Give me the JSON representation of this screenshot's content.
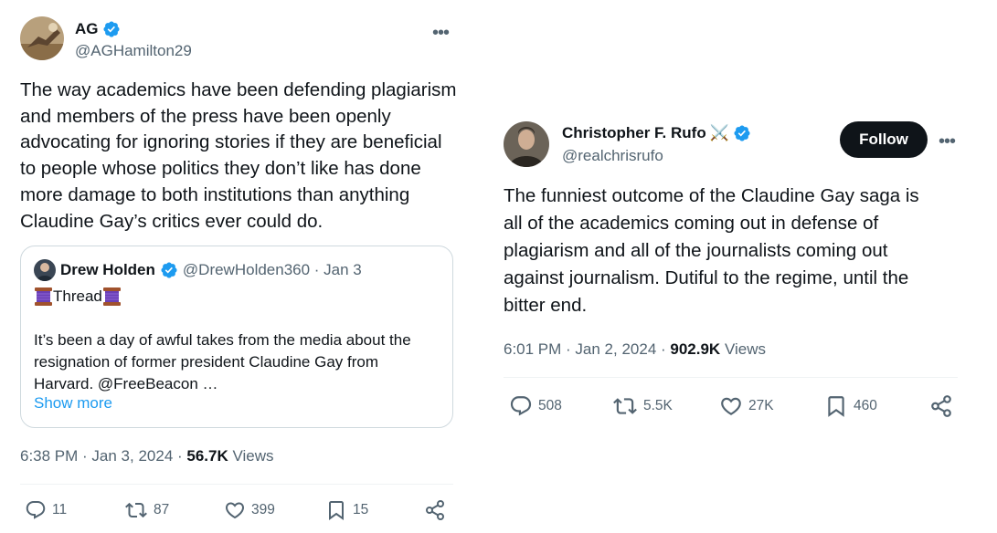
{
  "colors": {
    "verified": "#1d9bf0",
    "secondary_text": "#536471",
    "link": "#1d9bf0",
    "follow_bg": "#0f1419"
  },
  "left_tweet": {
    "display_name": "AG",
    "handle": "@AGHamilton29",
    "more_icon": "more-horizontal-icon",
    "text": "The way academics have been defending plagiarism\nand members of the press have been openly\nadvocating for ignoring stories if they are beneficial\nto people whose politics they don’t like has done\nmore damage to both institutions than anything\nClaudine Gay’s critics ever could do.",
    "quote": {
      "display_name": "Drew Holden",
      "handle_date": "@DrewHolden360 · Jan 3",
      "thread_label": "Thread",
      "text": "It’s been a day of awful takes from the media about the\nresignation of former president Claudine Gay from\nHarvard. @FreeBeacon …",
      "show_more": "Show more"
    },
    "timestamp": "6:38 PM · Jan 3, 2024 · ",
    "views_count": "56.7K",
    "views_label": " Views",
    "actions": {
      "replies": "11",
      "reposts": "87",
      "likes": "399",
      "bookmarks": "15"
    }
  },
  "right_tweet": {
    "display_name": "Christopher F. Rufo",
    "name_emoji": "⚔️",
    "handle": "@realchrisrufo",
    "follow_label": "Follow",
    "more_icon": "more-horizontal-icon",
    "text": "The funniest outcome of the Claudine Gay saga is\nall of the academics coming out in defense of\nplagiarism and all of the journalists coming out\nagainst journalism. Dutiful to the regime, until the\nbitter end.",
    "timestamp": "6:01 PM · Jan 2, 2024 · ",
    "views_count": "902.9K",
    "views_label": " Views",
    "actions": {
      "replies": "508",
      "reposts": "5.5K",
      "likes": "27K",
      "bookmarks": "460"
    }
  }
}
